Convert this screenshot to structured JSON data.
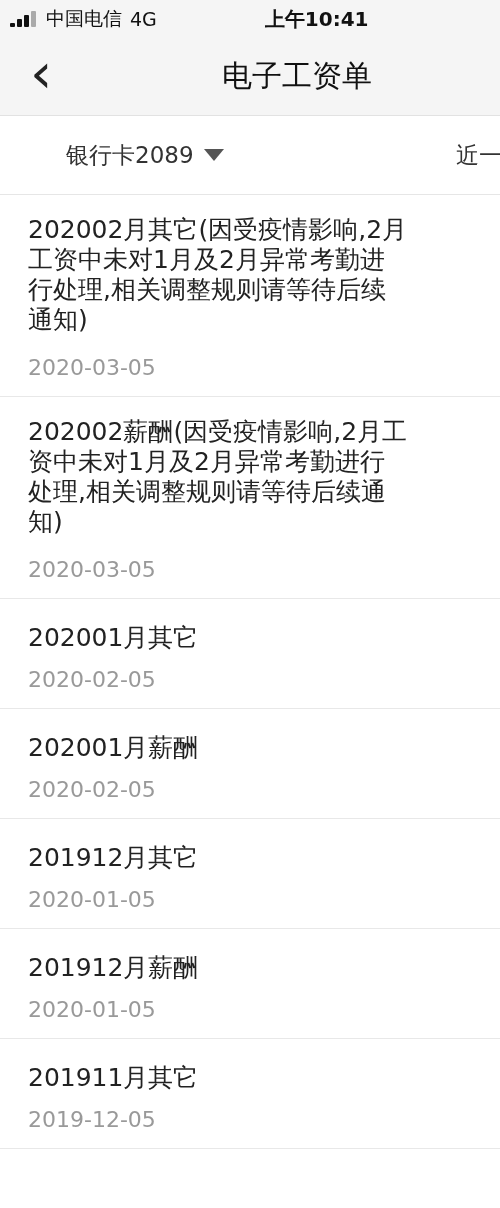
{
  "status_bar": {
    "carrier": "中国电信",
    "network": "4G",
    "time": "上午10:41"
  },
  "header": {
    "back": "‹",
    "title": "电子工资单"
  },
  "filters": {
    "card": "银行卡2089",
    "period": "近一"
  },
  "records": [
    {
      "title": "202002月其它(因受疫情影响,2月工资中未对1月及2月异常考勤进行处理,相关调整规则请等待后续通知)",
      "date": "2020-03-05"
    },
    {
      "title": "202002薪酬(因受疫情影响,2月工资中未对1月及2月异常考勤进行处理,相关调整规则请等待后续通知)",
      "date": "2020-03-05"
    },
    {
      "title": "202001月其它",
      "date": "2020-02-05"
    },
    {
      "title": "202001月薪酬",
      "date": "2020-02-05"
    },
    {
      "title": "201912月其它",
      "date": "2020-01-05"
    },
    {
      "title": "201912月薪酬",
      "date": "2020-01-05"
    },
    {
      "title": "201911月其它",
      "date": "2019-12-05"
    }
  ]
}
